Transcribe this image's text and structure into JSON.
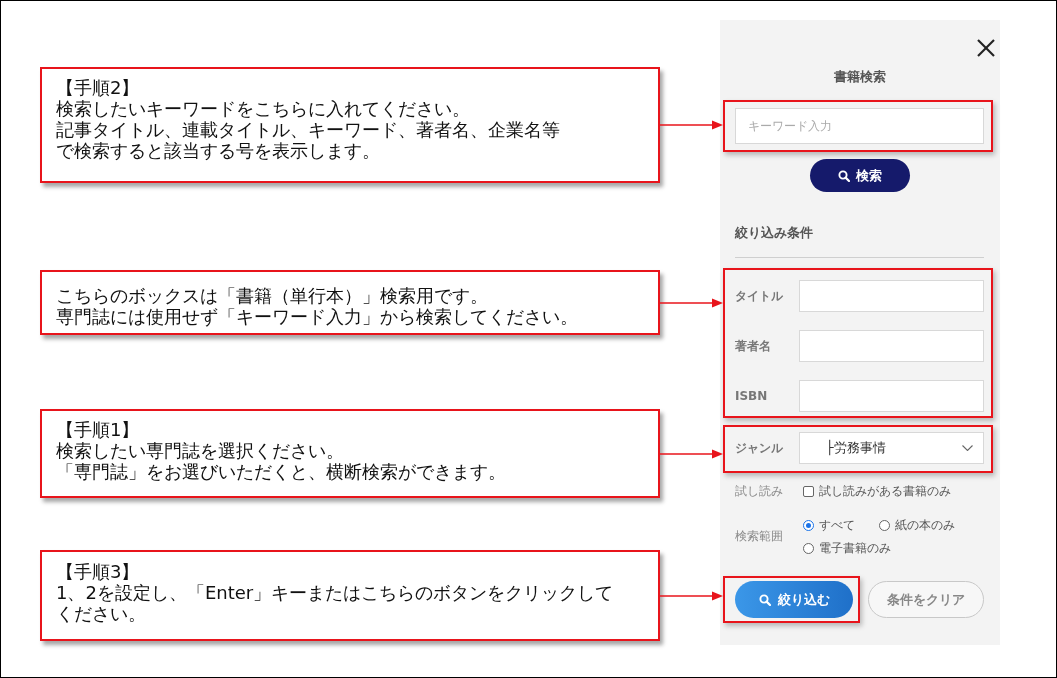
{
  "annotations": [
    {
      "lines": [
        "【手順2】",
        "検索したいキーワードをこちらに入れてください。",
        "記事タイトル、連載タイトル、キーワード、著者名、企業名等",
        "で検索すると該当する号を表示します。"
      ]
    },
    {
      "lines": [
        "こちらのボックスは「書籍（単行本）」検索用です。",
        "専門誌には使用せず「キーワード入力」から検索してください。"
      ]
    },
    {
      "lines": [
        "【手順1】",
        "検索したい専門誌を選択ください。",
        "「専門誌」をお選びいただくと、横断検索ができます。"
      ]
    },
    {
      "lines": [
        "【手順3】",
        "1、2を設定し、「Enter」キーまたはこちらのボタンをクリックして",
        "ください。"
      ]
    }
  ],
  "search_panel": {
    "title": "書籍検索",
    "keyword": {
      "placeholder": "キーワード入力",
      "highlighted": true
    },
    "search_button": "検索",
    "filter_heading": "絞り込み条件",
    "book_fields": {
      "highlighted": true,
      "fields": [
        {
          "label": "タイトル"
        },
        {
          "label": "著者名"
        },
        {
          "label": "ISBN"
        }
      ]
    },
    "genre": {
      "label": "ジャンル",
      "value": "├労務事情",
      "highlighted": true
    },
    "trial": {
      "label": "試し読み",
      "option": "試し読みがある書籍のみ",
      "checked": false
    },
    "scope": {
      "label": "検索範囲",
      "options": [
        {
          "label": "すべて",
          "selected": true
        },
        {
          "label": "紙の本のみ",
          "selected": false
        },
        {
          "label": "電子書籍のみ",
          "selected": false
        }
      ]
    },
    "filter_button": {
      "label": "絞り込む",
      "highlighted": true
    },
    "clear_button": "条件をクリア"
  }
}
